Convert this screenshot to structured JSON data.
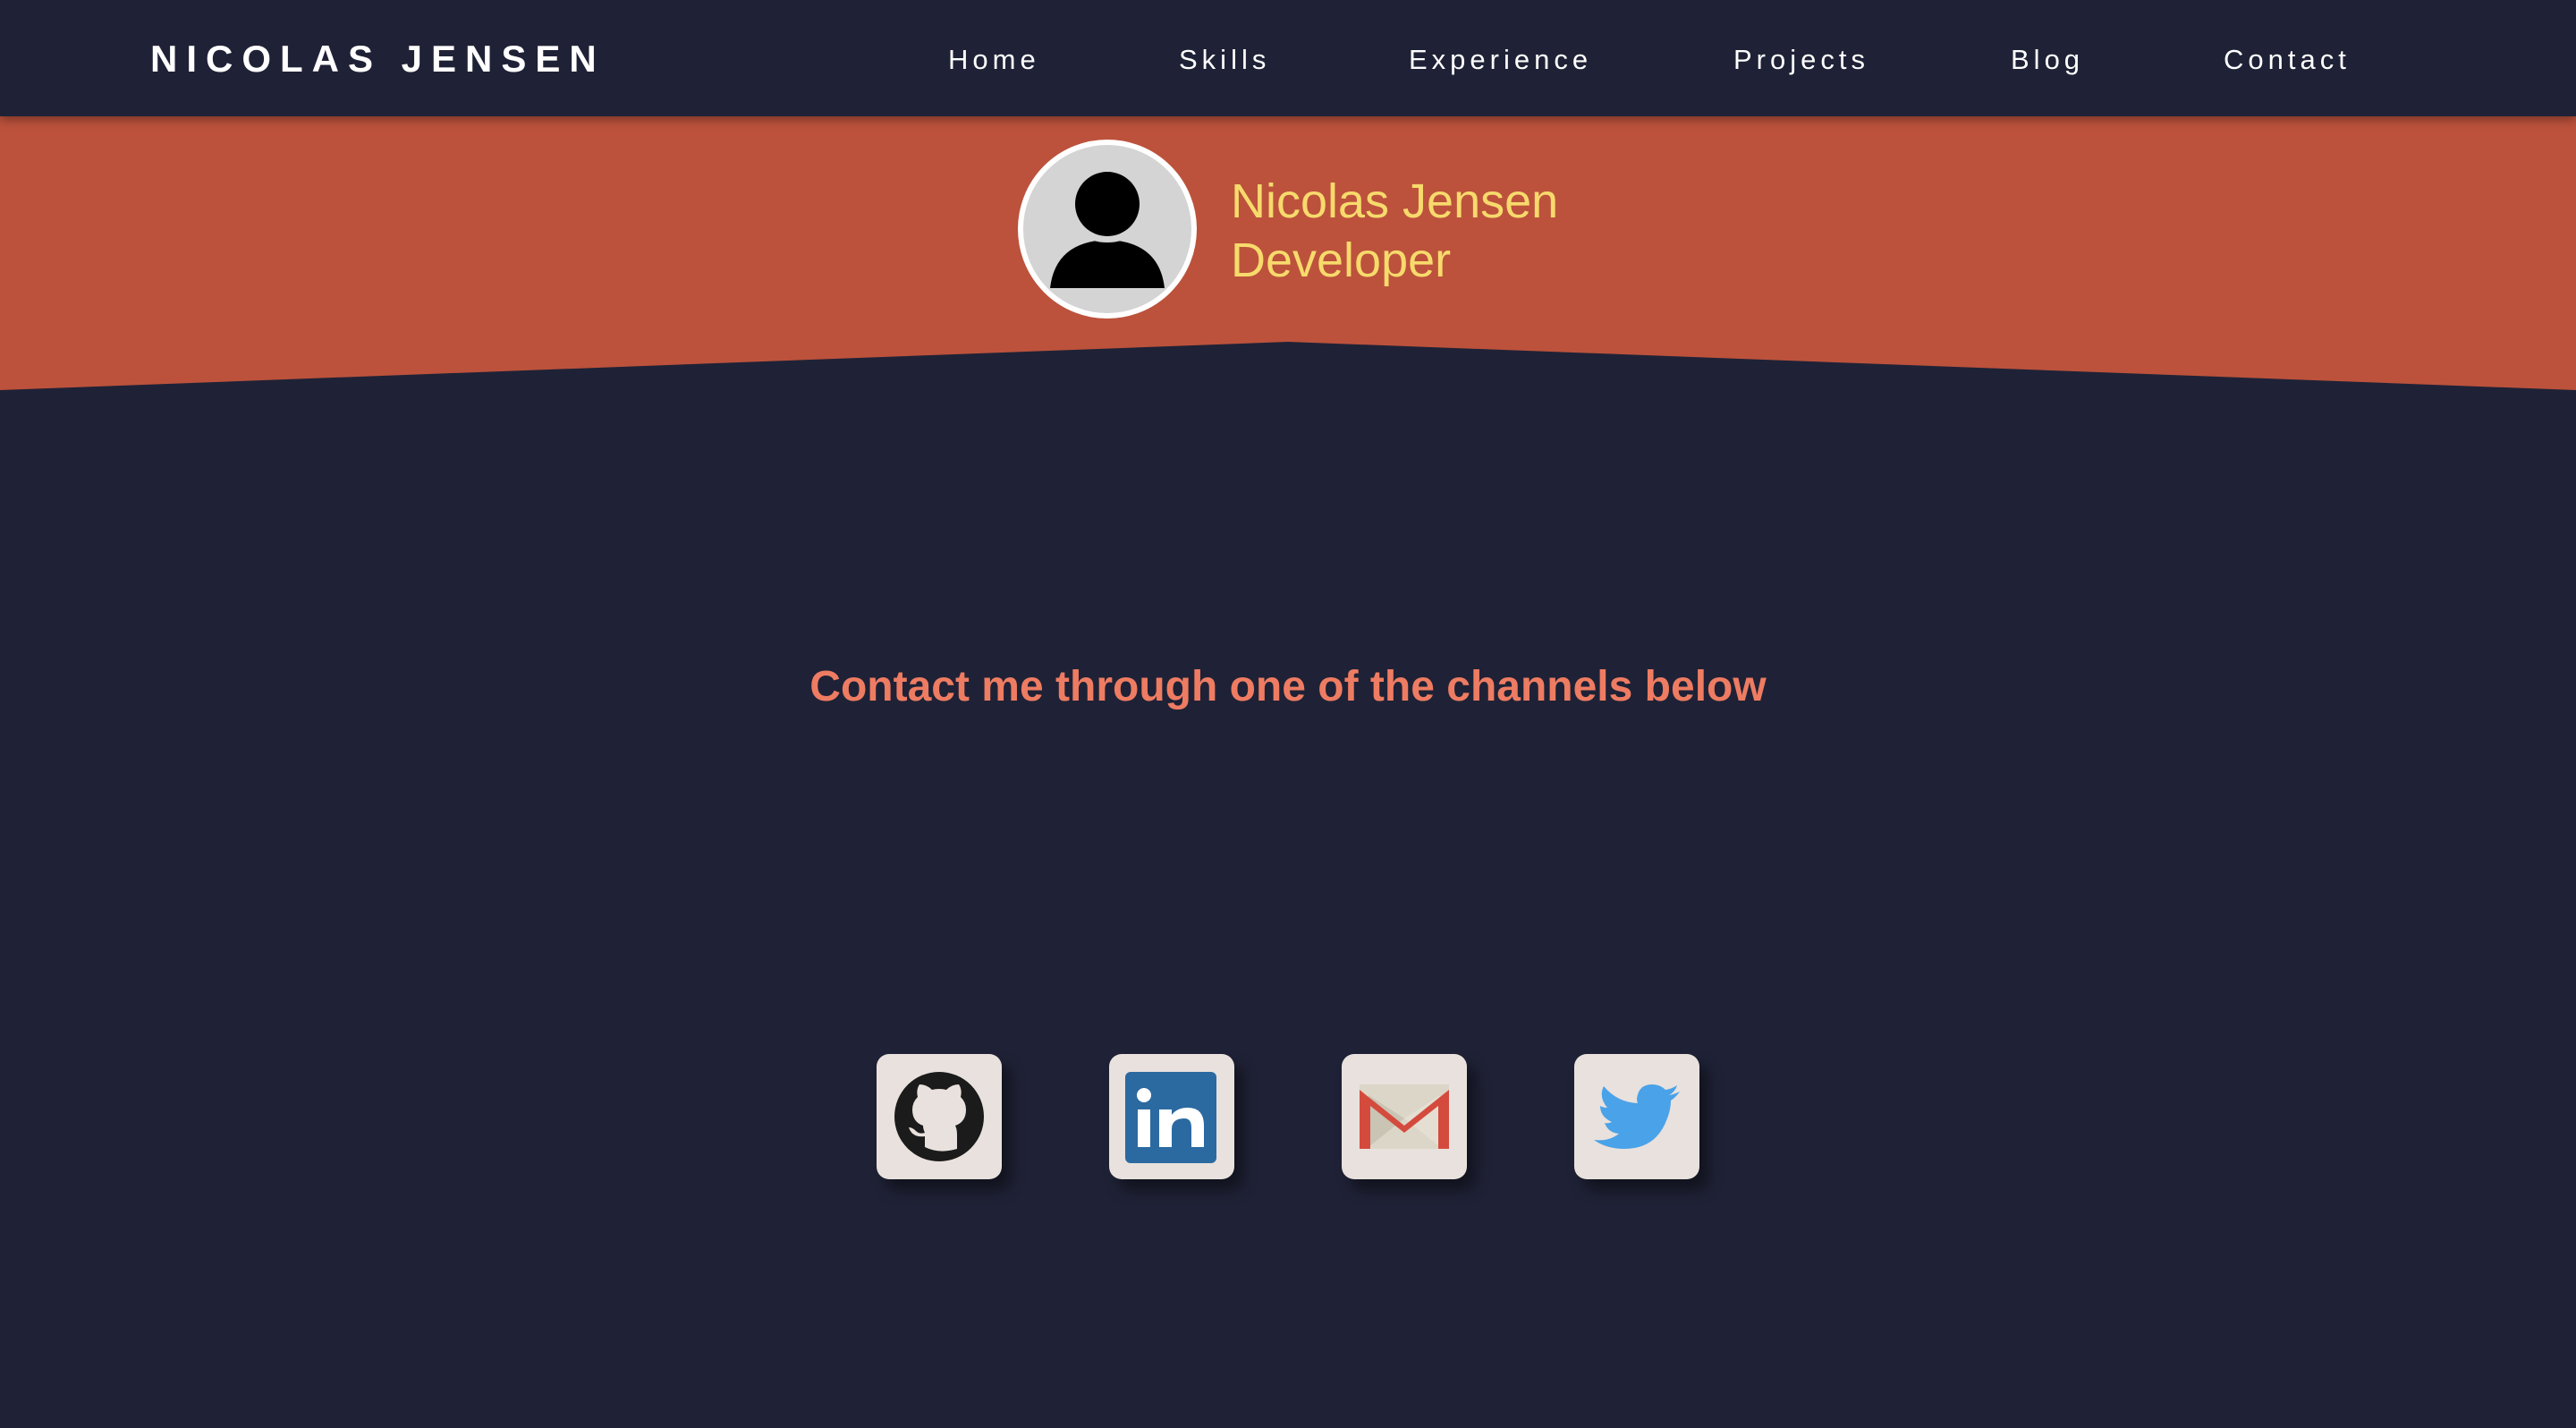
{
  "brand": "NICOLAS JENSEN",
  "nav": {
    "items": [
      {
        "label": "Home"
      },
      {
        "label": "Skills"
      },
      {
        "label": "Experience"
      },
      {
        "label": "Projects"
      },
      {
        "label": "Blog"
      },
      {
        "label": "Contact"
      }
    ]
  },
  "hero": {
    "name": "Nicolas Jensen",
    "role": "Developer",
    "avatar_icon": "user-silhouette-icon"
  },
  "contact": {
    "heading": "Contact me through one of the channels below",
    "channels": [
      {
        "icon": "github-icon"
      },
      {
        "icon": "linkedin-icon"
      },
      {
        "icon": "gmail-icon"
      },
      {
        "icon": "twitter-icon"
      }
    ]
  },
  "colors": {
    "background": "#1f2236",
    "hero_band": "#bc523c",
    "accent_yellow": "#f7da6c",
    "heading_coral": "#ee7c62",
    "tile": "#e8e1dd"
  }
}
